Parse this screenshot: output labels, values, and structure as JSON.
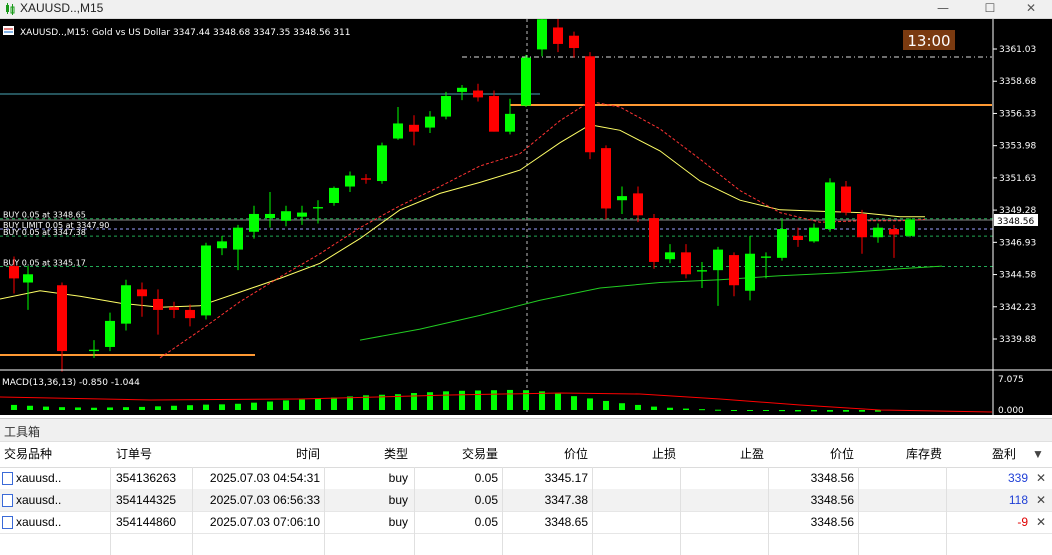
{
  "window": {
    "title": "XAUUSD..,M15",
    "buttons": {
      "minimize": "—",
      "maximize": "☐",
      "close": "✕"
    }
  },
  "chart": {
    "info_line": "XAUUSD..,M15:  Gold vs US Dollar  3347.44 3348.68 3347.35 3348.56  311",
    "time_badge": "13:00",
    "current_price_label": "3348.56",
    "price_axis_labels": [
      "3361.03",
      "3358.68",
      "3356.33",
      "3353.98",
      "3351.63",
      "3349.28",
      "3346.93",
      "3344.58",
      "3342.23",
      "3339.88"
    ],
    "order_labels": [
      {
        "text": "BUY 0.05 at 3348.65",
        "price": 3348.65
      },
      {
        "text": "BUY LIMIT 0.05 at 3347.90",
        "price": 3347.9
      },
      {
        "text": "BUY 0.05 at 3347.38",
        "price": 3347.38
      },
      {
        "text": "BUY 0.05 at 3345.17",
        "price": 3345.17
      }
    ],
    "macd_label": "MACD(13,36,13) -0.850 -1.044",
    "macd_axis_labels": [
      "7.075",
      "0.000"
    ],
    "colors": {
      "bull": "#00ff00",
      "bear": "#ff0000",
      "background": "#000000",
      "ma_fast": "#ffff66",
      "ma_slow": "#ff3333",
      "ma_long": "#22cc22",
      "level_orange": "#ff9933"
    }
  },
  "toolbox": {
    "title": "工具箱",
    "columns": [
      "交易品种",
      "订单号",
      "时间",
      "类型",
      "交易量",
      "价位",
      "止损",
      "止盈",
      "价位",
      "库存费",
      "盈利"
    ],
    "rows": [
      {
        "symbol": "xauusd..",
        "order": "354136263",
        "time": "2025.07.03 04:54:31",
        "type": "buy",
        "volume": "0.05",
        "price": "3345.17",
        "sl": "",
        "tp": "",
        "cur_price": "3348.56",
        "swap": "",
        "profit": "339",
        "profit_sign": "pos"
      },
      {
        "symbol": "xauusd..",
        "order": "354144325",
        "time": "2025.07.03 06:56:33",
        "type": "buy",
        "volume": "0.05",
        "price": "3347.38",
        "sl": "",
        "tp": "",
        "cur_price": "3348.56",
        "swap": "",
        "profit": "118",
        "profit_sign": "pos"
      },
      {
        "symbol": "xauusd..",
        "order": "354144860",
        "time": "2025.07.03 07:06:10",
        "type": "buy",
        "volume": "0.05",
        "price": "3348.65",
        "sl": "",
        "tp": "",
        "cur_price": "3348.56",
        "swap": "",
        "profit": "-9",
        "profit_sign": "neg"
      }
    ]
  }
}
